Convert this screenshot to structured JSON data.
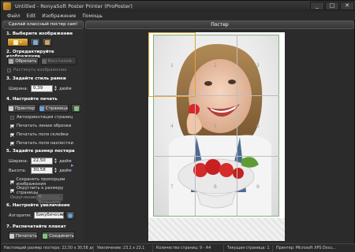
{
  "window": {
    "title": "Untitled - RonyaSoft Poster Printer (ProPoster)",
    "controls": [
      "_",
      "□",
      "✕"
    ]
  },
  "menu": [
    "Файл",
    "Edit",
    "Изображение",
    "Помощь"
  ],
  "left": {
    "slogan": "Сделай классный постер сам!",
    "s1": {
      "title": "1. Выберите изображение"
    },
    "s2": {
      "title": "2. Отредактируйте изображение",
      "crop": "Обрезать",
      "restore": "Восстанов...",
      "stretch": "Растянуть изображение"
    },
    "s3": {
      "title": "3. Задайте стиль рамки",
      "width_label": "Ширина:",
      "width_value": "0,39",
      "unit": "дюйм"
    },
    "s4": {
      "title": "4. Настройте печать",
      "printer": "Принтер",
      "page": "Страница",
      "checks": [
        {
          "label": "Автоориентация страниц",
          "checked": false
        },
        {
          "label": "Печатать линии обрезки",
          "checked": true
        },
        {
          "label": "Печатать поля склейки",
          "checked": true
        },
        {
          "label": "Печатать поля нахлестки",
          "checked": true
        }
      ]
    },
    "s5": {
      "title": "5. Задайте размер постера",
      "width_label": "Ширина:",
      "width_value": "22,50",
      "height_label": "Высота:",
      "height_value": "30,58",
      "unit": "дюйм",
      "checks": [
        {
          "label": "Сохранять пропорции изображения",
          "checked": true
        },
        {
          "label": "Округлить к размеру страницы",
          "checked": true
        }
      ],
      "round_label": "Округление:",
      "round_value": "К большему"
    },
    "s6": {
      "title": "6. Настройте увеличение",
      "algo_label": "Алгоритм:",
      "algo_value": "Бикубический"
    },
    "s7": {
      "title": "7. Распечатайте плакат",
      "print": "Печатать",
      "join": "Соединить"
    }
  },
  "poster": {
    "title": "Постер",
    "tiles": [
      "1",
      "2",
      "3",
      "4",
      "5",
      "6",
      "7",
      "8",
      "9"
    ],
    "highlight_tile": 1
  },
  "status": [
    "Настоящий размер постера: 22,50 x 30,58 дюйм",
    "Увеличение: 23,1 x 23,1",
    "Количество страниц: 9 - A4",
    "Текущая страница: 1",
    "Принтер: Microsoft XPS Docu..."
  ],
  "colors": {
    "accent": "#e0a33a",
    "margin_line": "#7fb07f",
    "grid": "#bdbdbd"
  }
}
